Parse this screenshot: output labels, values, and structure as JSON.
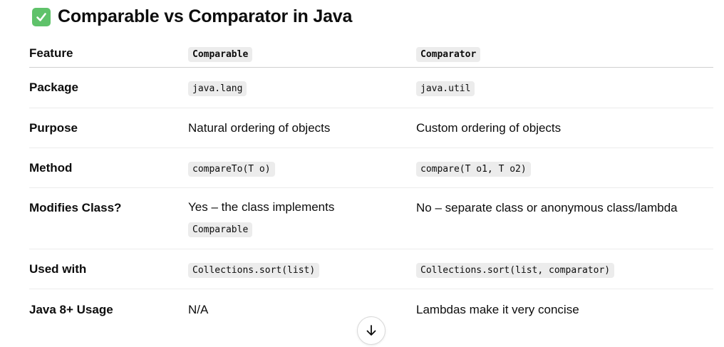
{
  "heading": {
    "icon": "check-mark-button-icon",
    "icon_color": "#5fc26a",
    "title": "Comparable vs Comparator in Java"
  },
  "table": {
    "headers": [
      {
        "text": "Feature",
        "code": false
      },
      {
        "text": "Comparable",
        "code": true
      },
      {
        "text": "Comparator",
        "code": true
      }
    ],
    "rows": [
      {
        "feature": "Package",
        "comparable": "java.lang",
        "comparable_code": true,
        "comparator": "java.util",
        "comparator_code": true
      },
      {
        "feature": "Purpose",
        "comparable": "Natural ordering of objects",
        "comparable_code": false,
        "comparator": "Custom ordering of objects",
        "comparator_code": false
      },
      {
        "feature": "Method",
        "comparable": "compareTo(T o)",
        "comparable_code": true,
        "comparator": "compare(T o1, T o2)",
        "comparator_code": true
      },
      {
        "feature": "Modifies Class?",
        "comparable_text": "Yes – the class implements",
        "comparable_code_text": "Comparable",
        "comparator": "No – separate class or anonymous class/lambda",
        "comparator_code": false
      },
      {
        "feature": "Used with",
        "comparable": "Collections.sort(list)",
        "comparable_code": true,
        "comparator": "Collections.sort(list, comparator)",
        "comparator_code": true
      },
      {
        "feature": "Java 8+ Usage",
        "comparable": "N/A",
        "comparable_code": false,
        "comparator": "Lambdas make it very concise",
        "comparator_code": false
      }
    ]
  },
  "scroll_button": {
    "icon": "arrow-down-icon"
  }
}
